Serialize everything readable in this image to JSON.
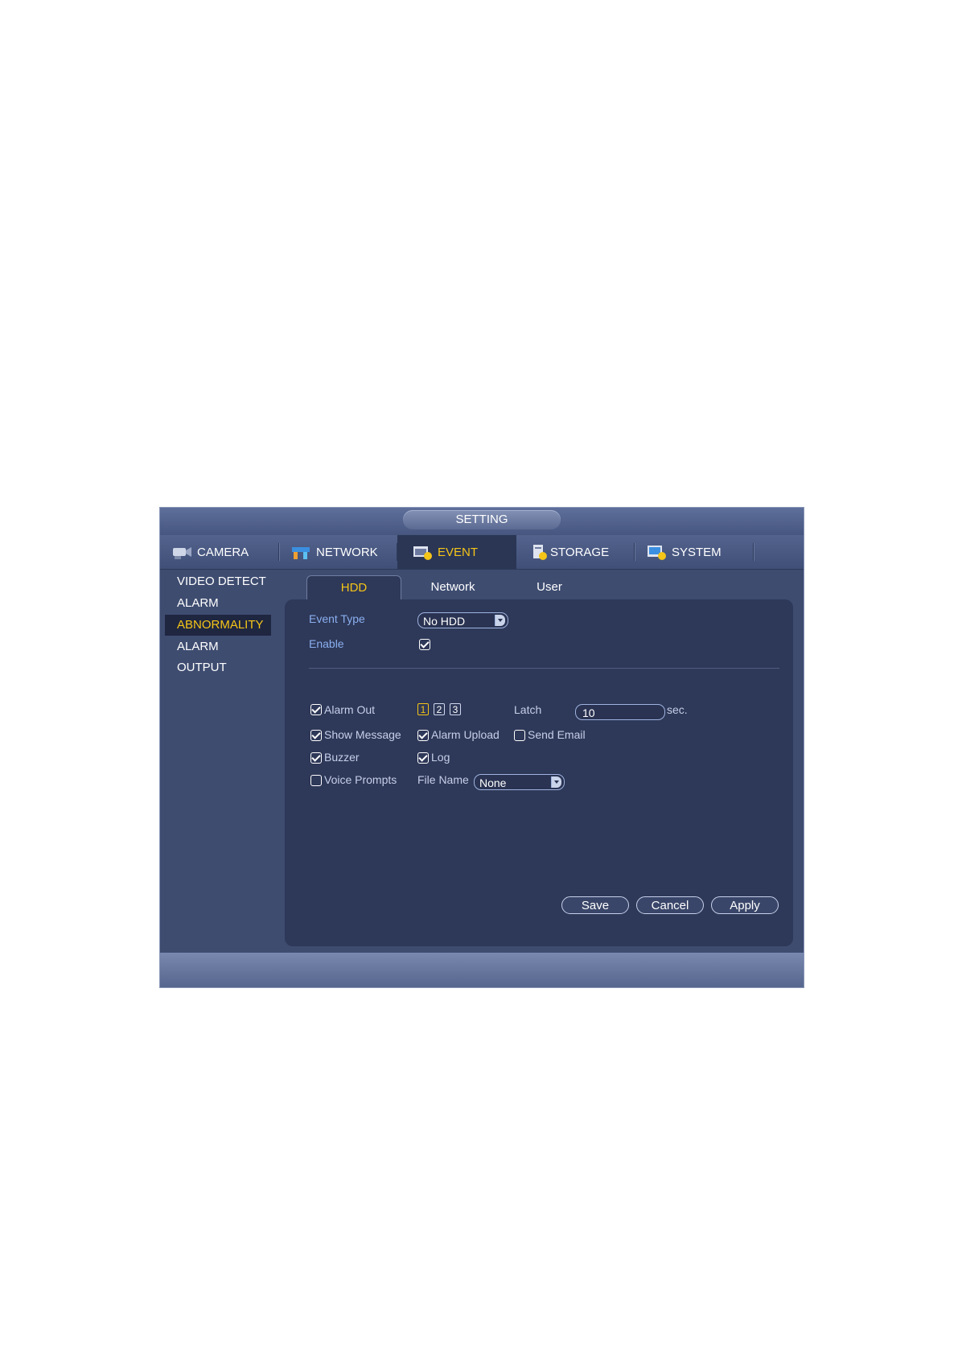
{
  "window": {
    "title": "SETTING"
  },
  "main_tabs": [
    {
      "label": "CAMERA",
      "icon": "camera-icon"
    },
    {
      "label": "NETWORK",
      "icon": "network-icon"
    },
    {
      "label": "EVENT",
      "icon": "event-icon",
      "active": true
    },
    {
      "label": "STORAGE",
      "icon": "storage-icon"
    },
    {
      "label": "SYSTEM",
      "icon": "system-icon"
    }
  ],
  "sidebar": {
    "items": [
      {
        "label": "VIDEO DETECT"
      },
      {
        "label": "ALARM"
      },
      {
        "label": "ABNORMALITY",
        "active": true
      },
      {
        "label": "ALARM OUTPUT"
      }
    ]
  },
  "sub_tabs": [
    {
      "label": "HDD",
      "active": true
    },
    {
      "label": "Network"
    },
    {
      "label": "User"
    }
  ],
  "form": {
    "event_type_label": "Event Type",
    "event_type_value": "No HDD",
    "enable_label": "Enable",
    "enable_checked": true,
    "alarm_out_label": "Alarm Out",
    "alarm_out_checked": true,
    "alarm_out_channels": [
      "1",
      "2",
      "3"
    ],
    "latch_label": "Latch",
    "latch_value": "10",
    "latch_unit": "sec.",
    "show_message_label": "Show Message",
    "show_message_checked": true,
    "alarm_upload_label": "Alarm Upload",
    "alarm_upload_checked": true,
    "send_email_label": "Send Email",
    "send_email_checked": false,
    "buzzer_label": "Buzzer",
    "buzzer_checked": true,
    "log_label": "Log",
    "log_checked": true,
    "voice_prompts_label": "Voice Prompts",
    "voice_prompts_checked": false,
    "file_name_label": "File Name",
    "file_name_value": "None"
  },
  "buttons": {
    "save": "Save",
    "cancel": "Cancel",
    "apply": "Apply"
  },
  "colors": {
    "accent": "#f5c518",
    "panel": "#2e3858",
    "window": "#3e4c70",
    "label_blue": "#8ab0f0"
  }
}
